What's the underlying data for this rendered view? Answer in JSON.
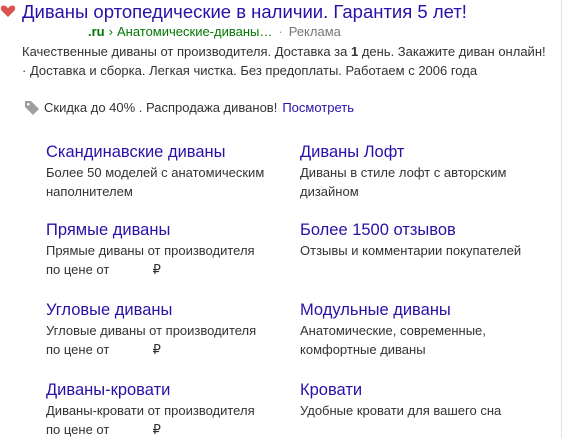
{
  "ad": {
    "title": "Диваны ортопедические в наличии. Гарантия 5 лет!",
    "domain": ".ru",
    "breadcrumb_sep": "›",
    "path": "Анатомические-диваны…",
    "ad_label": "Реклама",
    "description_before_bold": "Качественные диваны от производителя. Доставка за ",
    "description_bold": "1",
    "description_after_bold": " день. Закажите диван онлайн! · Доставка и сборка. Легкая чистка. Без предоплаты. Работаем с 2006 года",
    "promo_text": "Скидка до 40% . Распродажа диванов!",
    "promo_link": "Посмотреть",
    "colors": {
      "link": "#2a0fa8",
      "url": "#007700",
      "text": "#333333",
      "heart": "#d9534f"
    },
    "icons": [
      "heart-icon",
      "tag-icon"
    ]
  },
  "sitelinks": [
    {
      "title": "Скандинавские диваны",
      "desc": "Более 50 моделей с анатомическим\nнаполнителем"
    },
    {
      "title": "Диваны Лофт",
      "desc": "Диваны в стиле лофт с авторским\nдизайном"
    },
    {
      "title": "Прямые диваны",
      "desc_line1": "Прямые диваны от производителя",
      "desc_line2": "по цене от",
      "currency": "₽"
    },
    {
      "title": "Более 1500 отзывов",
      "desc": "Отзывы и комментарии покупателей"
    },
    {
      "title": "Угловые диваны",
      "desc_line1": "Угловые диваны от производителя",
      "desc_line2": "по цене от",
      "currency": "₽"
    },
    {
      "title": "Модульные диваны",
      "desc": "Анатомические, современные,\nкомфортные диваны"
    },
    {
      "title": "Диваны-кровати",
      "desc_line1": "Диваны-кровати от производителя",
      "desc_line2": "по цене от",
      "currency": "₽"
    },
    {
      "title": "Кровати",
      "desc": "Удобные кровати для вашего сна"
    }
  ]
}
